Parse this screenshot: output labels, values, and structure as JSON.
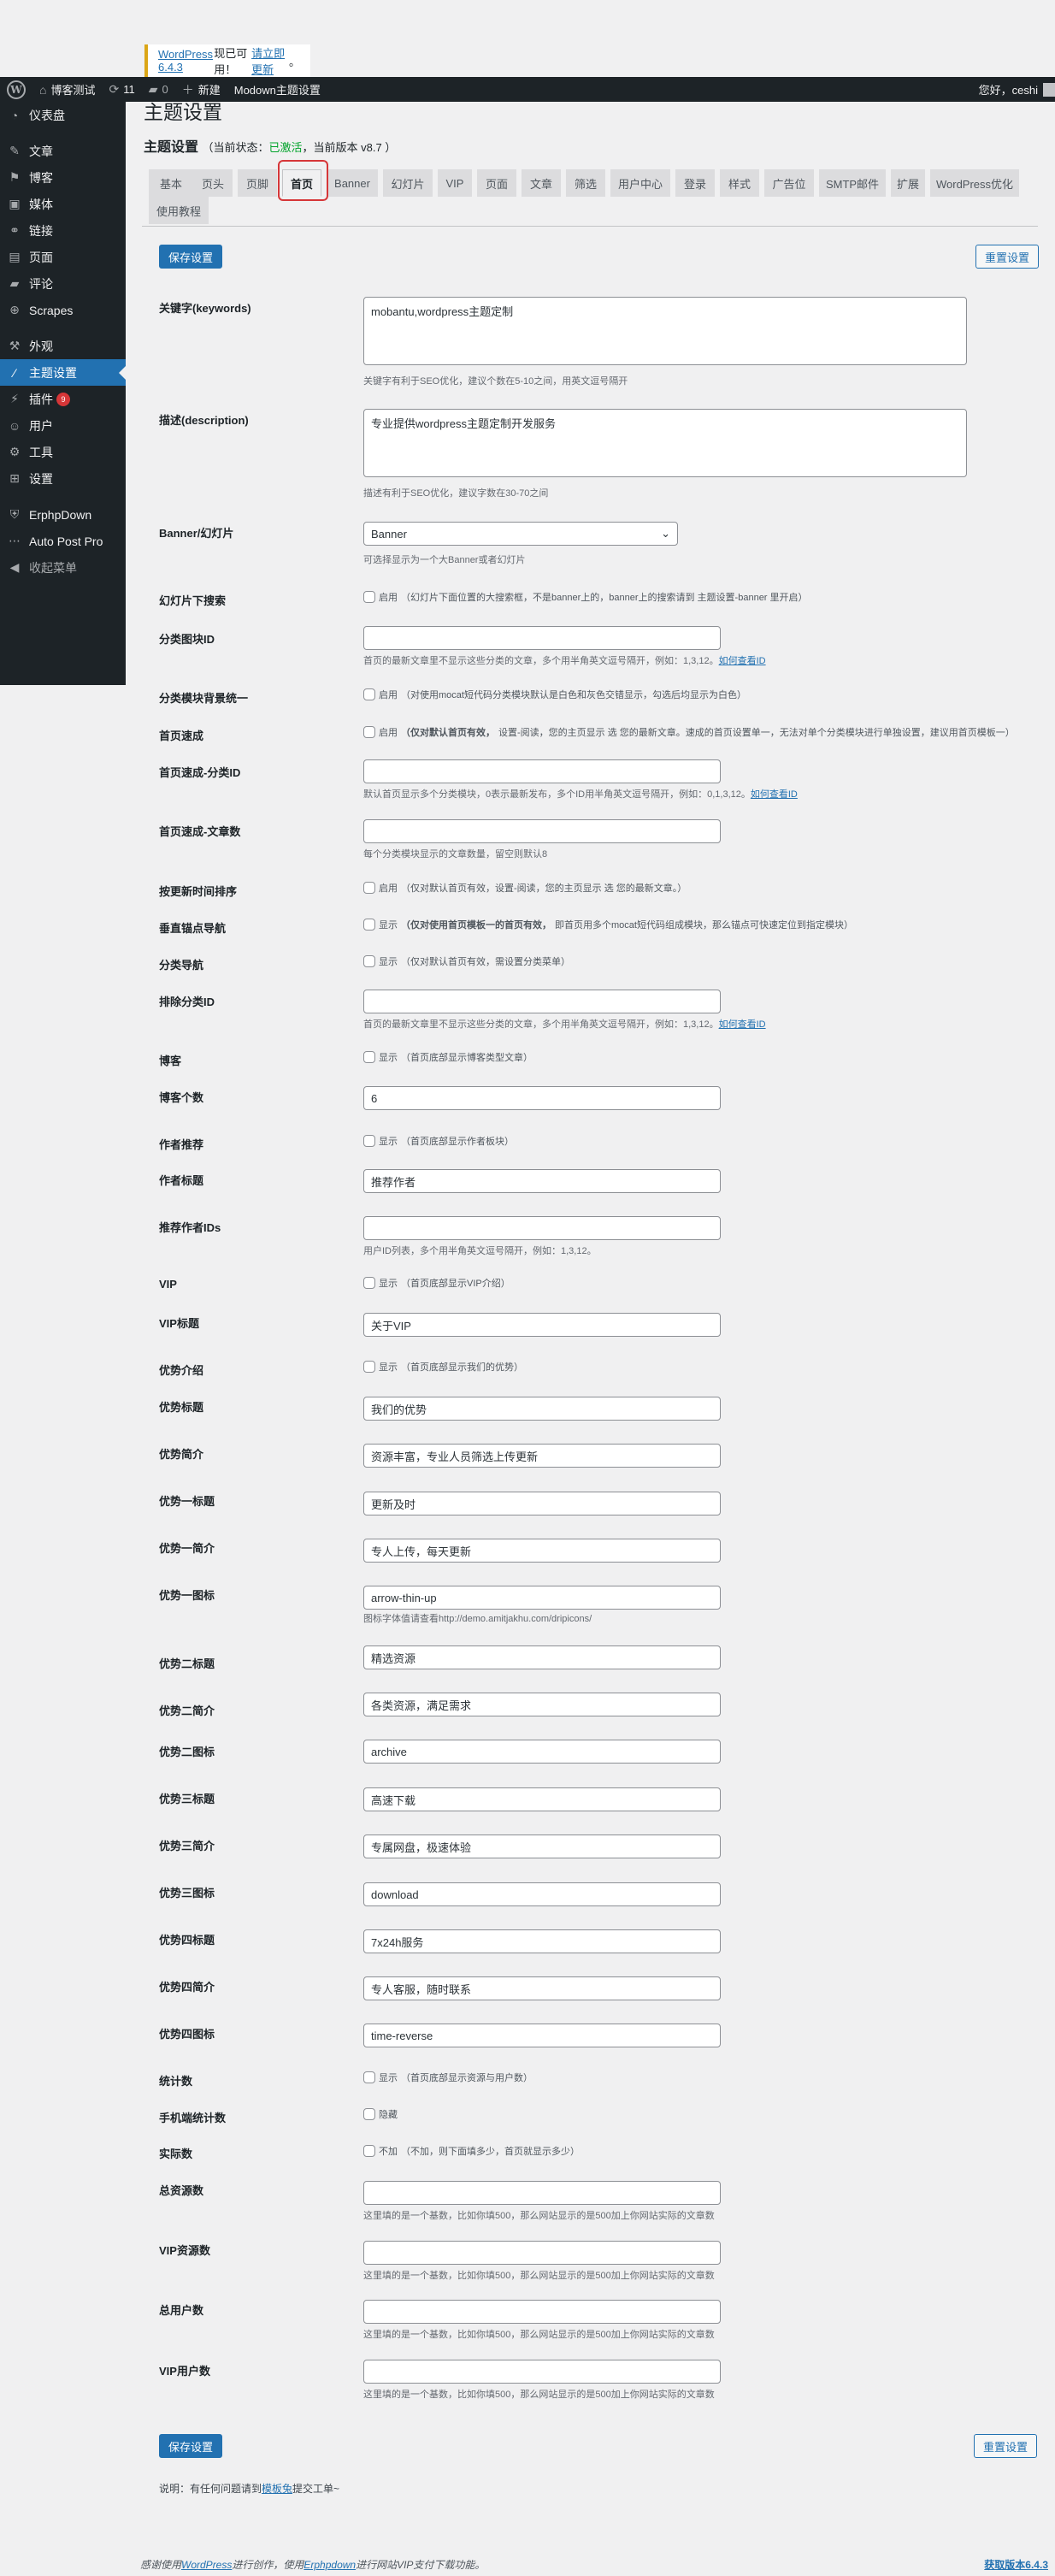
{
  "notice": {
    "link_text": "WordPress 6.4.3",
    "text": "现已可用！",
    "update_link": "请立即更新",
    "end": "。"
  },
  "adminbar": {
    "wp_logo": "W",
    "site_name": "博客测试",
    "updates_count": "11",
    "comments_count": "0",
    "new_label": "新建",
    "page_label": "Modown主题设置",
    "greeting": "您好，ceshi"
  },
  "sidebar": {
    "items": [
      {
        "label": "仪表盘",
        "icon": "◔"
      },
      {
        "label": "文章",
        "icon": "✎"
      },
      {
        "label": "博客",
        "icon": "⚑"
      },
      {
        "label": "媒体",
        "icon": "▣"
      },
      {
        "label": "链接",
        "icon": "⚭"
      },
      {
        "label": "页面",
        "icon": "▤"
      },
      {
        "label": "评论",
        "icon": "▰"
      },
      {
        "label": "Scrapes",
        "icon": "⊕"
      },
      {
        "label": "外观",
        "icon": "⚒"
      },
      {
        "label": "主题设置",
        "icon": "⁄"
      },
      {
        "label": "插件",
        "icon": "⚡",
        "badge": "9"
      },
      {
        "label": "用户",
        "icon": "☺"
      },
      {
        "label": "工具",
        "icon": "⚙"
      },
      {
        "label": "设置",
        "icon": "⊞"
      },
      {
        "label": "ErphpDown",
        "icon": "⛨"
      },
      {
        "label": "Auto Post Pro",
        "icon": "⋯"
      },
      {
        "label": "收起菜单",
        "icon": "◀"
      }
    ],
    "active": "主题设置"
  },
  "page": {
    "title_cut": "主题设置",
    "heading": "主题设置",
    "status_prefix": "（当前状态：",
    "status_value": "已激活",
    "status_suffix": "，当前版本 v8.7 ）",
    "accent": "#2271b1",
    "status_color": "#00a32a"
  },
  "tabs": [
    "基本",
    "页头",
    "页脚",
    "首页",
    "Banner",
    "幻灯片",
    "VIP",
    "页面",
    "文章",
    "筛选",
    "用户中心",
    "登录",
    "样式",
    "广告位",
    "SMTP邮件",
    "扩展",
    "WordPress优化",
    "使用教程"
  ],
  "active_tab": "首页",
  "buttons": {
    "save": "保存设置",
    "reset": "重置设置"
  },
  "fields": {
    "keywords": {
      "label": "关键字(keywords)",
      "value": "mobantu,wordpress主题定制",
      "desc": "关键字有利于SEO优化，建议个数在5-10之间，用英文逗号隔开"
    },
    "description": {
      "label": "描述(description)",
      "value": "专业提供wordpress主题定制开发服务",
      "desc": "描述有利于SEO优化，建议字数在30-70之间"
    },
    "banner": {
      "label": "Banner/幻灯片",
      "value": "Banner",
      "desc": "可选择显示为一个大Banner或者幻灯片"
    },
    "slide_search": {
      "label": "幻灯片下搜索",
      "check_label": "启用",
      "desc": "（幻灯片下面位置的大搜索框，不是banner上的，banner上的搜索请到 主题设置-banner 里开启）"
    },
    "cat_block_id": {
      "label": "分类图块ID",
      "value": "",
      "desc": "首页的最新文章里不显示这些分类的文章，多个用半角英文逗号隔开，例如：1,3,12。",
      "link": "如何查看ID"
    },
    "cat_bg_same": {
      "label": "分类模块背景统一",
      "check_label": "启用",
      "desc": "（对使用mocat短代码分类模块默认是白色和灰色交错显示，勾选后均显示为白色）"
    },
    "home_quick": {
      "label": "首页速成",
      "check_label": "启用",
      "desc_bold": "（仅对默认首页有效，",
      "desc": "设置-阅读，您的主页显示 选 您的最新文章。速成的首页设置单一，无法对单个分类模块进行单独设置，建议用首页模板一）"
    },
    "home_quick_cat": {
      "label": "首页速成-分类ID",
      "value": "",
      "desc": "默认首页显示多个分类模块，0表示最新发布，多个ID用半角英文逗号隔开，例如：0,1,3,12。",
      "link": "如何查看ID"
    },
    "home_quick_num": {
      "label": "首页速成-文章数",
      "value": "",
      "desc": "每个分类模块显示的文章数量，留空则默认8"
    },
    "order_update": {
      "label": "按更新时间排序",
      "check_label": "启用",
      "desc": "（仅对默认首页有效，设置-阅读，您的主页显示 选 您的最新文章。）"
    },
    "anchor_nav": {
      "label": "垂直锚点导航",
      "check_label": "显示",
      "desc_bold": "（仅对使用首页模板一的首页有效，",
      "desc": "即首页用多个mocat短代码组成模块，那么锚点可快速定位到指定模块）"
    },
    "cat_nav": {
      "label": "分类导航",
      "check_label": "显示",
      "desc": "（仅对默认首页有效，需设置分类菜单）"
    },
    "exclude_cat": {
      "label": "排除分类ID",
      "value": "",
      "desc": "首页的最新文章里不显示这些分类的文章，多个用半角英文逗号隔开，例如：1,3,12。",
      "link": "如何查看ID"
    },
    "blog": {
      "label": "博客",
      "check_label": "显示",
      "desc": "（首页底部显示博客类型文章）"
    },
    "blog_num": {
      "label": "博客个数",
      "value": "6"
    },
    "author_rec": {
      "label": "作者推荐",
      "check_label": "显示",
      "desc": "（首页底部显示作者板块）"
    },
    "author_title": {
      "label": "作者标题",
      "value": "推荐作者"
    },
    "author_ids": {
      "label": "推荐作者IDs",
      "value": "",
      "desc": "用户ID列表，多个用半角英文逗号隔开，例如：1,3,12。"
    },
    "vip": {
      "label": "VIP",
      "check_label": "显示",
      "desc": "（首页底部显示VIP介绍）"
    },
    "vip_title": {
      "label": "VIP标题",
      "value": "关于VIP"
    },
    "adv_intro": {
      "label": "优势介绍",
      "check_label": "显示",
      "desc": "（首页底部显示我们的优势）"
    },
    "adv_title": {
      "label": "优势标题",
      "value": "我们的优势"
    },
    "adv_summary": {
      "label": "优势简介",
      "value": "资源丰富，专业人员筛选上传更新"
    },
    "adv1_title": {
      "label": "优势一标题",
      "value": "更新及时"
    },
    "adv1_summary": {
      "label": "优势一简介",
      "value": "专人上传，每天更新"
    },
    "adv1_icon": {
      "label": "优势一图标",
      "value": "arrow-thin-up",
      "desc": "图标字体值请查看http://demo.amitjakhu.com/dripicons/"
    },
    "adv2_title": {
      "label": "优势二标题",
      "value": "精选资源"
    },
    "adv2_summary": {
      "label": "优势二简介",
      "value": "各类资源，满足需求"
    },
    "adv2_icon": {
      "label": "优势二图标",
      "value": "archive"
    },
    "adv3_title": {
      "label": "优势三标题",
      "value": "高速下载"
    },
    "adv3_summary": {
      "label": "优势三简介",
      "value": "专属网盘，极速体验"
    },
    "adv3_icon": {
      "label": "优势三图标",
      "value": "download"
    },
    "adv4_title": {
      "label": "优势四标题",
      "value": "7x24h服务"
    },
    "adv4_summary": {
      "label": "优势四简介",
      "value": "专人客服，随时联系"
    },
    "adv4_icon": {
      "label": "优势四图标",
      "value": "time-reverse"
    },
    "stats": {
      "label": "统计数",
      "check_label": "显示",
      "desc": "（首页底部显示资源与用户数）"
    },
    "mobile_stats": {
      "label": "手机端统计数",
      "check_label": "隐藏"
    },
    "actual": {
      "label": "实际数",
      "check_label": "不加",
      "desc": "（不加，则下面填多少，首页就显示多少）"
    },
    "total_res": {
      "label": "总资源数",
      "value": "",
      "desc": "这里填的是一个基数，比如你填500，那么网站显示的是500加上你网站实际的文章数"
    },
    "vip_res": {
      "label": "VIP资源数",
      "value": "",
      "desc": "这里填的是一个基数，比如你填500，那么网站显示的是500加上你网站实际的文章数"
    },
    "total_users": {
      "label": "总用户数",
      "value": "",
      "desc": "这里填的是一个基数，比如你填500，那么网站显示的是500加上你网站实际的文章数"
    },
    "vip_users": {
      "label": "VIP用户数",
      "value": "",
      "desc": "这里填的是一个基数，比如你填500，那么网站显示的是500加上你网站实际的文章数"
    }
  },
  "note": {
    "prefix": "说明：有任何问题请到",
    "link": "模板兔",
    "suffix": "提交工单~"
  },
  "footer": {
    "text1": "感谢使用",
    "link1": "WordPress",
    "text2": "进行创作，使用",
    "link2": "Erphpdown",
    "text3": "进行网站VIP支付下载功能。",
    "version_link": "获取版本6.4.3"
  }
}
